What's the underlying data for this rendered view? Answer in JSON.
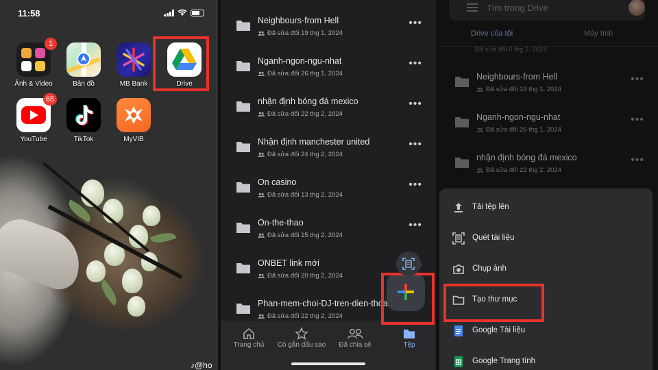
{
  "home": {
    "time": "11:58",
    "apps": [
      {
        "label": "Ảnh & Video",
        "badge": "1"
      },
      {
        "label": "Bản đồ"
      },
      {
        "label": "MB Bank"
      },
      {
        "label": "Drive"
      },
      {
        "label": "YouTube",
        "badge": "65"
      },
      {
        "label": "TikTok"
      },
      {
        "label": "MyVIB"
      }
    ],
    "watermark": "♪@ho"
  },
  "drive_list": {
    "items": [
      {
        "name": "Neighbours-from Hell",
        "modified": "Đã sửa đổi 19 thg 1, 2024"
      },
      {
        "name": "Nganh-ngon-ngu-nhat",
        "modified": "Đã sửa đổi 26 thg 1, 2024"
      },
      {
        "name": "nhận định bóng đá mexico",
        "modified": "Đã sửa đổi 22 thg 2, 2024"
      },
      {
        "name": "Nhận định manchester united",
        "modified": "Đã sửa đổi 24 thg 2, 2024"
      },
      {
        "name": "On casino",
        "modified": "Đã sửa đổi 13 thg 2, 2024"
      },
      {
        "name": "On-the-thao",
        "modified": "Đã sửa đổi 15 thg 2, 2024"
      },
      {
        "name": "ONBET link mới",
        "modified": "Đã sửa đổi 20 thg 2, 2024"
      },
      {
        "name": "Phan-mem-choi-DJ-tren-dien-thoai",
        "modified": "Đã sửa đổi 22 thg 2, 2024"
      }
    ],
    "more_label": "•••",
    "nav": [
      {
        "label": "Trang chủ"
      },
      {
        "label": "Có gắn dấu sao"
      },
      {
        "label": "Đã chia sẻ"
      },
      {
        "label": "Tệp"
      }
    ]
  },
  "drive_menu": {
    "search_placeholder": "Tìm trong Drive",
    "tabs": [
      "Drive của tôi",
      "Máy tính"
    ],
    "partial_modified": "Đã sửa đổi 6 thg 2, 2024",
    "items": [
      {
        "name": "Neighbours-from Hell",
        "modified": "Đã sửa đổi 19 thg 1, 2024"
      },
      {
        "name": "Nganh-ngon-ngu-nhat",
        "modified": "Đã sửa đổi 26 thg 1, 2024"
      },
      {
        "name": "nhận định bóng đá mexico",
        "modified": "Đã sửa đổi 22 thg 2, 2024"
      }
    ],
    "actions": [
      {
        "label": "Tải tệp lên",
        "icon": "upload-icon"
      },
      {
        "label": "Quét tài liệu",
        "icon": "scan-icon"
      },
      {
        "label": "Chụp ảnh",
        "icon": "camera-icon"
      },
      {
        "label": "Tạo thư mục",
        "icon": "folder-icon"
      },
      {
        "label": "Google Tài liệu",
        "icon": "docs-icon"
      },
      {
        "label": "Google Trang tính",
        "icon": "sheets-icon"
      }
    ]
  },
  "colors": {
    "highlight": "#e8322b",
    "accent": "#8ab4f8",
    "drive_bg": "#1f1f21"
  }
}
